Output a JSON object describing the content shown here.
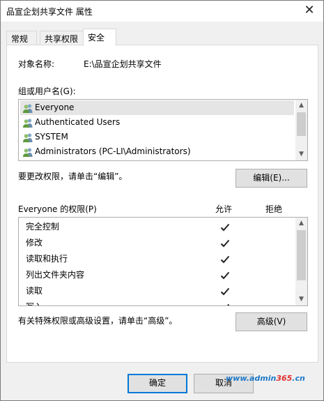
{
  "window": {
    "title": "品宣企划共享文件 属性",
    "close_symbol": "✕"
  },
  "tabs": [
    {
      "label": "常规",
      "active": false
    },
    {
      "label": "共享权限",
      "active": false
    },
    {
      "label": "安全",
      "active": true
    }
  ],
  "security": {
    "object_name_label": "对象名称:",
    "object_name_value": "E:\\品宣企划共享文件",
    "groups_label": "组或用户名(G):",
    "users": [
      {
        "name": "Everyone",
        "icon": "users-group-icon",
        "selected": true
      },
      {
        "name": "Authenticated Users",
        "icon": "users-group-icon",
        "selected": false
      },
      {
        "name": "SYSTEM",
        "icon": "users-group-icon",
        "selected": false
      },
      {
        "name": "Administrators (PC-LI\\Administrators)",
        "icon": "users-group-icon",
        "selected": false
      }
    ],
    "edit_hint": "要更改权限，请单击“编辑”。",
    "edit_button": "编辑(E)...",
    "permissions_label": "Everyone 的权限(P)",
    "allow_header": "允许",
    "deny_header": "拒绝",
    "permissions": [
      {
        "name": "完全控制",
        "allow": true,
        "deny": false
      },
      {
        "name": "修改",
        "allow": true,
        "deny": false
      },
      {
        "name": "读取和执行",
        "allow": true,
        "deny": false
      },
      {
        "name": "列出文件夹内容",
        "allow": true,
        "deny": false
      },
      {
        "name": "读取",
        "allow": true,
        "deny": false
      },
      {
        "name": "写入",
        "allow": true,
        "deny": false
      }
    ],
    "advanced_hint": "有关特殊权限或高级设置，请单击“高级”。",
    "advanced_button": "高级(V)"
  },
  "footer": {
    "ok_button": "确定",
    "cancel_button": "取消"
  },
  "watermark": {
    "part1": "www.admin",
    "part2": "365",
    "part3": ".cn"
  },
  "colors": {
    "accent": "#0078d7",
    "selection": "#e5e5e5",
    "watermark_blue": "#1e78c8",
    "watermark_red": "#e03030"
  }
}
